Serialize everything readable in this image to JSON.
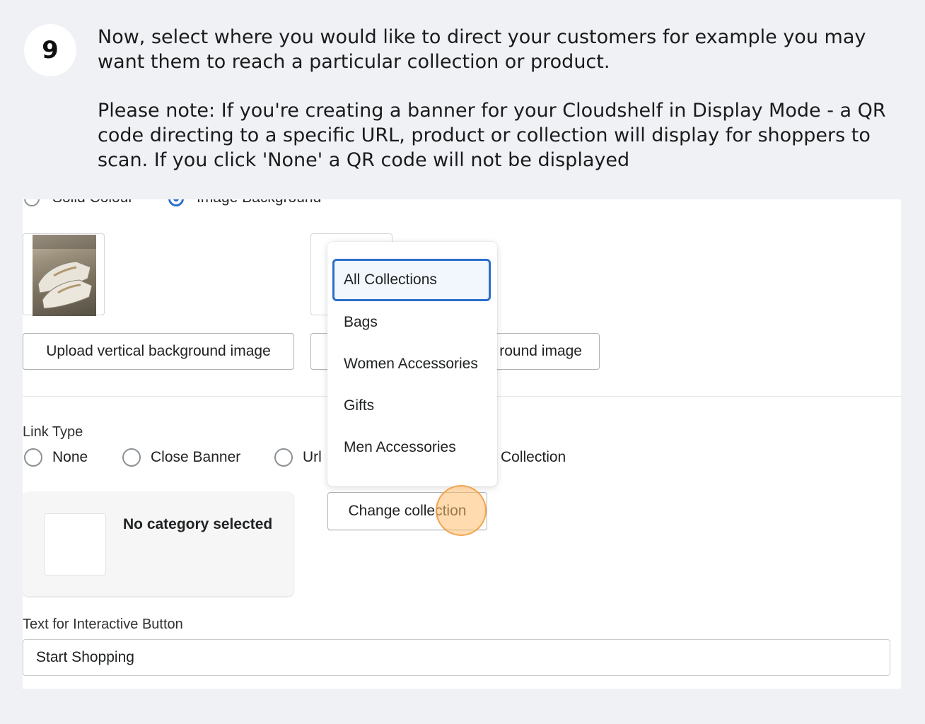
{
  "step": {
    "number": "9"
  },
  "instructions": {
    "main": "Now, select where you would like to direct your customers for example you may want them to reach a particular collection or product.",
    "note": "Please note: If you're creating a banner for your Cloudshelf in Display Mode - a QR code directing to a specific URL, product or collection will display for shoppers to scan. If you click 'None' a QR code will not be displayed"
  },
  "background_options": {
    "solid": "Solid Colour",
    "image": "Image Background",
    "selected": "image"
  },
  "upload": {
    "vertical_label": "Upload vertical background image",
    "horizontal_label_visible": "round image"
  },
  "link_type": {
    "label": "Link Type",
    "options": [
      "None",
      "Close Banner",
      "Url",
      "Collection"
    ]
  },
  "collection_card": {
    "empty_text": "No category selected"
  },
  "change_collection_button": "Change collection",
  "dropdown": {
    "options": [
      "All Collections",
      "Bags",
      "Women Accessories",
      "Gifts",
      "Men Accessories"
    ],
    "selected": "All Collections"
  },
  "interactive_button": {
    "label": "Text for Interactive Button",
    "value": "Start Shopping"
  },
  "colors": {
    "accent": "#2c6ecb",
    "page_bg": "#eff1f5",
    "click_highlight": "#f5b56a"
  }
}
